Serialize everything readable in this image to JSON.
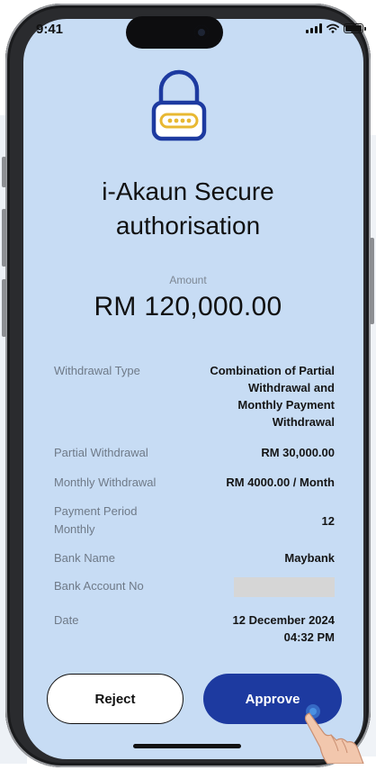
{
  "status_bar": {
    "time": "9:41"
  },
  "header": {
    "title_line1": "i-Akaun Secure",
    "title_line2": "authorisation"
  },
  "amount": {
    "label": "Amount",
    "value": "RM 120,000.00"
  },
  "details": {
    "withdrawal_type": {
      "label": "Withdrawal Type",
      "lines": [
        "Combination of Partial",
        "Withdrawal  and",
        "Monthly Payment",
        "Withdrawal"
      ]
    },
    "partial_withdrawal": {
      "label": "Partial Withdrawal",
      "value": "RM 30,000.00"
    },
    "monthly_withdrawal": {
      "label": "Monthly Withdrawal",
      "value": "RM 4000.00 / Month"
    },
    "payment_period": {
      "label_lines": [
        "Payment Period",
        "Monthly"
      ],
      "value": "12"
    },
    "bank_name": {
      "label": "Bank Name",
      "value": "Maybank"
    },
    "bank_account": {
      "label": "Bank Account No",
      "value_masked": true
    },
    "date": {
      "label": "Date",
      "value_lines": [
        "12 December 2024",
        "04:32 PM"
      ]
    }
  },
  "actions": {
    "reject_label": "Reject",
    "approve_label": "Approve"
  },
  "colors": {
    "screen_bg": "#c7dcf4",
    "approve_bg": "#1d3aa0",
    "lock_accent": "#e8b832",
    "lock_stroke": "#1d3aa0"
  },
  "icons": [
    "lock-icon",
    "signal-icon",
    "wifi-icon",
    "battery-icon",
    "hand-pointer-icon"
  ]
}
